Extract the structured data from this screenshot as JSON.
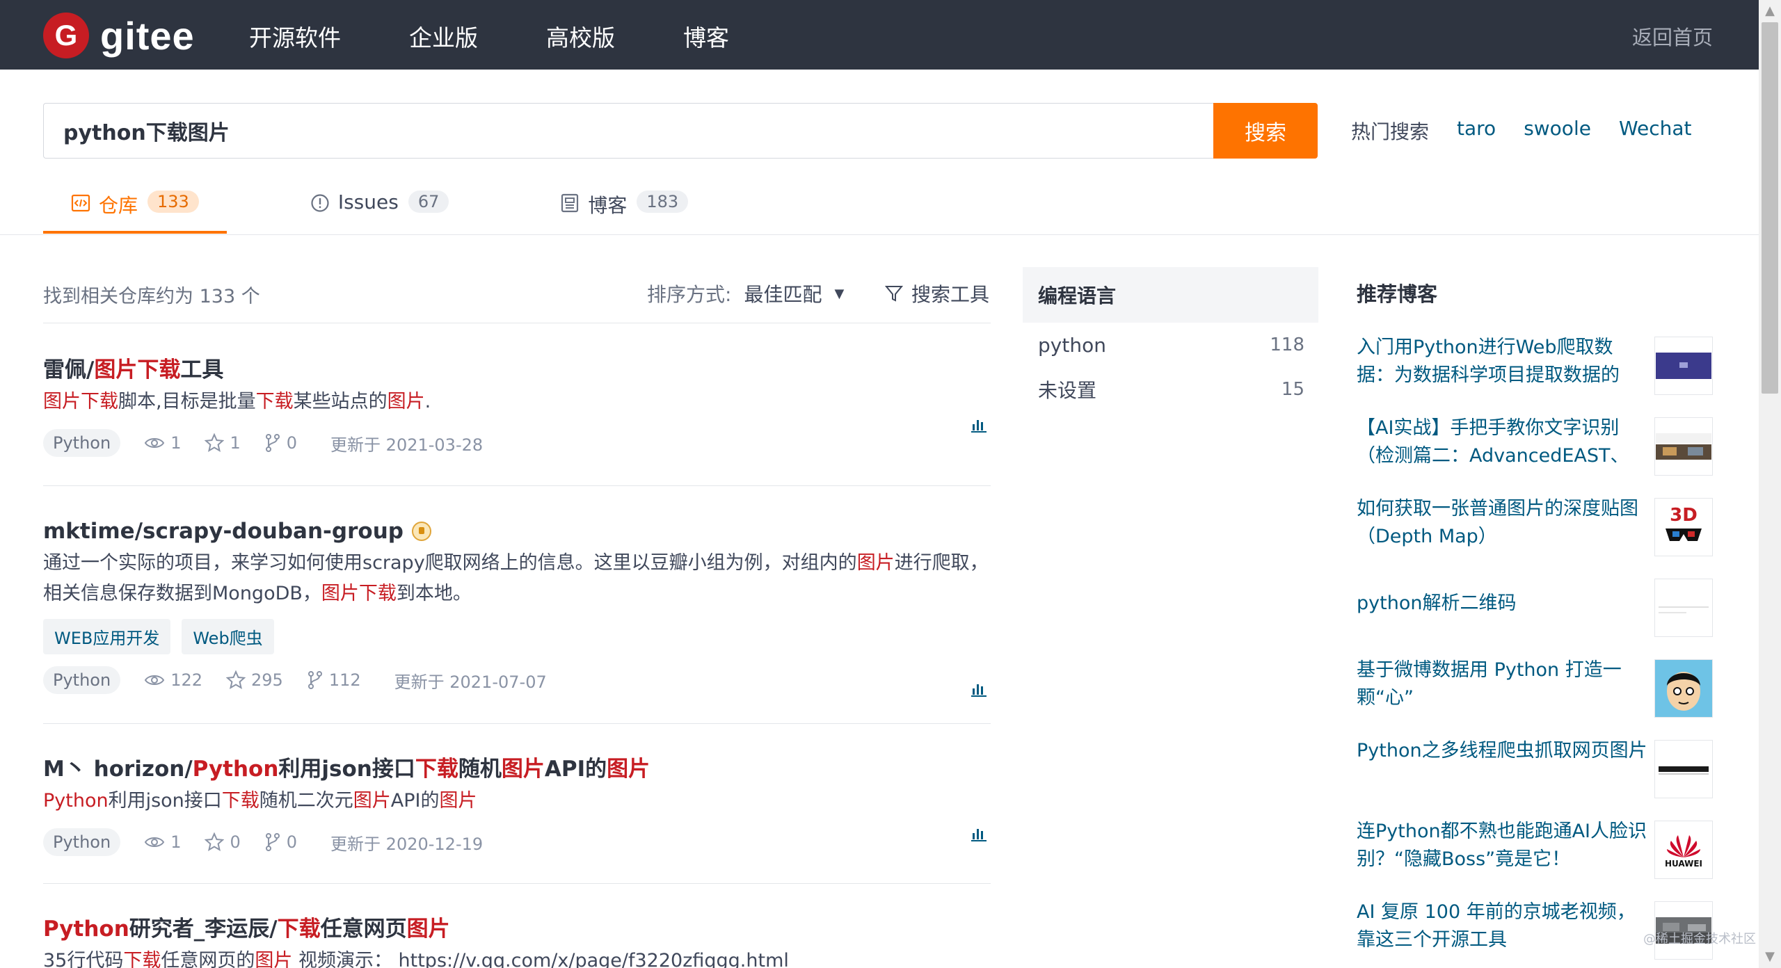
{
  "header": {
    "logo_text": "gitee",
    "logo_mark": "G",
    "nav": [
      "开源软件",
      "企业版",
      "高校版",
      "博客"
    ],
    "home_link": "返回首页"
  },
  "search": {
    "query": "python下载图片",
    "button": "搜索",
    "hot_label": "热门搜索",
    "hot_terms": [
      "taro",
      "swoole",
      "Wechat"
    ]
  },
  "tabs": [
    {
      "label": "仓库",
      "count": "133",
      "icon": "code-icon",
      "active": true
    },
    {
      "label": "Issues",
      "count": "67",
      "icon": "issue-icon",
      "active": false
    },
    {
      "label": "博客",
      "count": "183",
      "icon": "blog-icon",
      "active": false
    }
  ],
  "results": {
    "summary": "找到相关仓库约为 133 个",
    "sort_label": "排序方式:",
    "sort_value": "最佳匹配",
    "tools_label": "搜索工具"
  },
  "repos": [
    {
      "title_parts": [
        [
          "雷佩/",
          false
        ],
        [
          "图片下载",
          true
        ],
        [
          "工具",
          false
        ]
      ],
      "desc_parts": [
        [
          "图片下载",
          true
        ],
        [
          "脚本,目标是批量",
          false
        ],
        [
          "下载",
          true
        ],
        [
          "某些站点的",
          false
        ],
        [
          "图片",
          true
        ],
        [
          ".",
          false
        ]
      ],
      "tags": [],
      "language": "Python",
      "watch": "1",
      "star": "1",
      "fork": "0",
      "updated": "更新于 2021-03-28",
      "gvp": false
    },
    {
      "title_parts": [
        [
          "mktime/scrapy-douban-group",
          false
        ]
      ],
      "desc_parts": [
        [
          "通过一个实际的项目，来学习如何使用scrapy爬取网络上的信息。这里以豆瓣小组为例，对组内的",
          false
        ],
        [
          "图片",
          true
        ],
        [
          "进行爬取，相关信息保存数据到MongoDB，",
          false
        ],
        [
          "图片下载",
          true
        ],
        [
          "到本地。",
          false
        ]
      ],
      "tags": [
        "WEB应用开发",
        "Web爬虫"
      ],
      "language": "Python",
      "watch": "122",
      "star": "295",
      "fork": "112",
      "updated": "更新于 2021-07-07",
      "gvp": true
    },
    {
      "title_parts": [
        [
          "M丶 horizon/",
          false
        ],
        [
          "Python",
          true
        ],
        [
          "利用json接口",
          false
        ],
        [
          "下载",
          true
        ],
        [
          "随机",
          false
        ],
        [
          "图片",
          true
        ],
        [
          "API的",
          false
        ],
        [
          "图片",
          true
        ]
      ],
      "desc_parts": [
        [
          "Python",
          true
        ],
        [
          "利用json接口",
          false
        ],
        [
          "下载",
          true
        ],
        [
          "随机二次元",
          false
        ],
        [
          "图片",
          true
        ],
        [
          "API的",
          false
        ],
        [
          "图片",
          true
        ]
      ],
      "tags": [],
      "language": "Python",
      "watch": "1",
      "star": "0",
      "fork": "0",
      "updated": "更新于 2020-12-19",
      "gvp": false
    },
    {
      "title_parts": [
        [
          "Python",
          true
        ],
        [
          "研究者_李运辰/",
          false
        ],
        [
          "下载",
          true
        ],
        [
          "任意网页",
          false
        ],
        [
          "图片",
          true
        ]
      ],
      "desc_parts": [
        [
          "35行代码",
          false
        ],
        [
          "下载",
          true
        ],
        [
          "任意网页的",
          false
        ],
        [
          "图片",
          true
        ],
        [
          " 视频演示： https://v.qq.com/x/page/f3220zfiqgg.html",
          false
        ]
      ],
      "tags": [],
      "language": "",
      "watch": "",
      "star": "",
      "fork": "",
      "updated": "",
      "gvp": false
    }
  ],
  "languages": {
    "title": "编程语言",
    "items": [
      {
        "name": "python",
        "count": "118"
      },
      {
        "name": "未设置",
        "count": "15"
      }
    ]
  },
  "blogs": {
    "title": "推荐博客",
    "items": [
      {
        "title": "入门用Python进行Web爬取数据：为数据科学项目提取数据的",
        "thumb": "screen-thumb"
      },
      {
        "title": "【AI实战】手把手教你文字识别（检测篇二：AdvancedEAST、",
        "thumb": "ocr-thumb"
      },
      {
        "title": "如何获取一张普通图片的深度贴图（Depth Map）",
        "thumb": "3d-glasses-thumb",
        "thumb_text": "3D"
      },
      {
        "title": "python解析二维码",
        "thumb": "qrcode-thumb"
      },
      {
        "title": "基于微博数据用 Python 打造一颗“心”",
        "thumb": "avatar-thumb"
      },
      {
        "title": "Python之多线程爬虫抓取网页图片",
        "thumb": "bar-thumb"
      },
      {
        "title": "连Python都不熟也能跑通AI人脸识别？“隐藏Boss”竟是它！",
        "thumb": "huawei-thumb",
        "thumb_text": "HUAWEI"
      },
      {
        "title": "AI 复原 100 年前的京城老视频，靠这三个开源工具",
        "thumb": "old-video-thumb"
      }
    ]
  },
  "watermark": "@稀土掘金技术社区",
  "colors": {
    "header_bg": "#2e3440",
    "accent": "#fe7300",
    "highlight": "#c71d23",
    "link": "#005980"
  }
}
